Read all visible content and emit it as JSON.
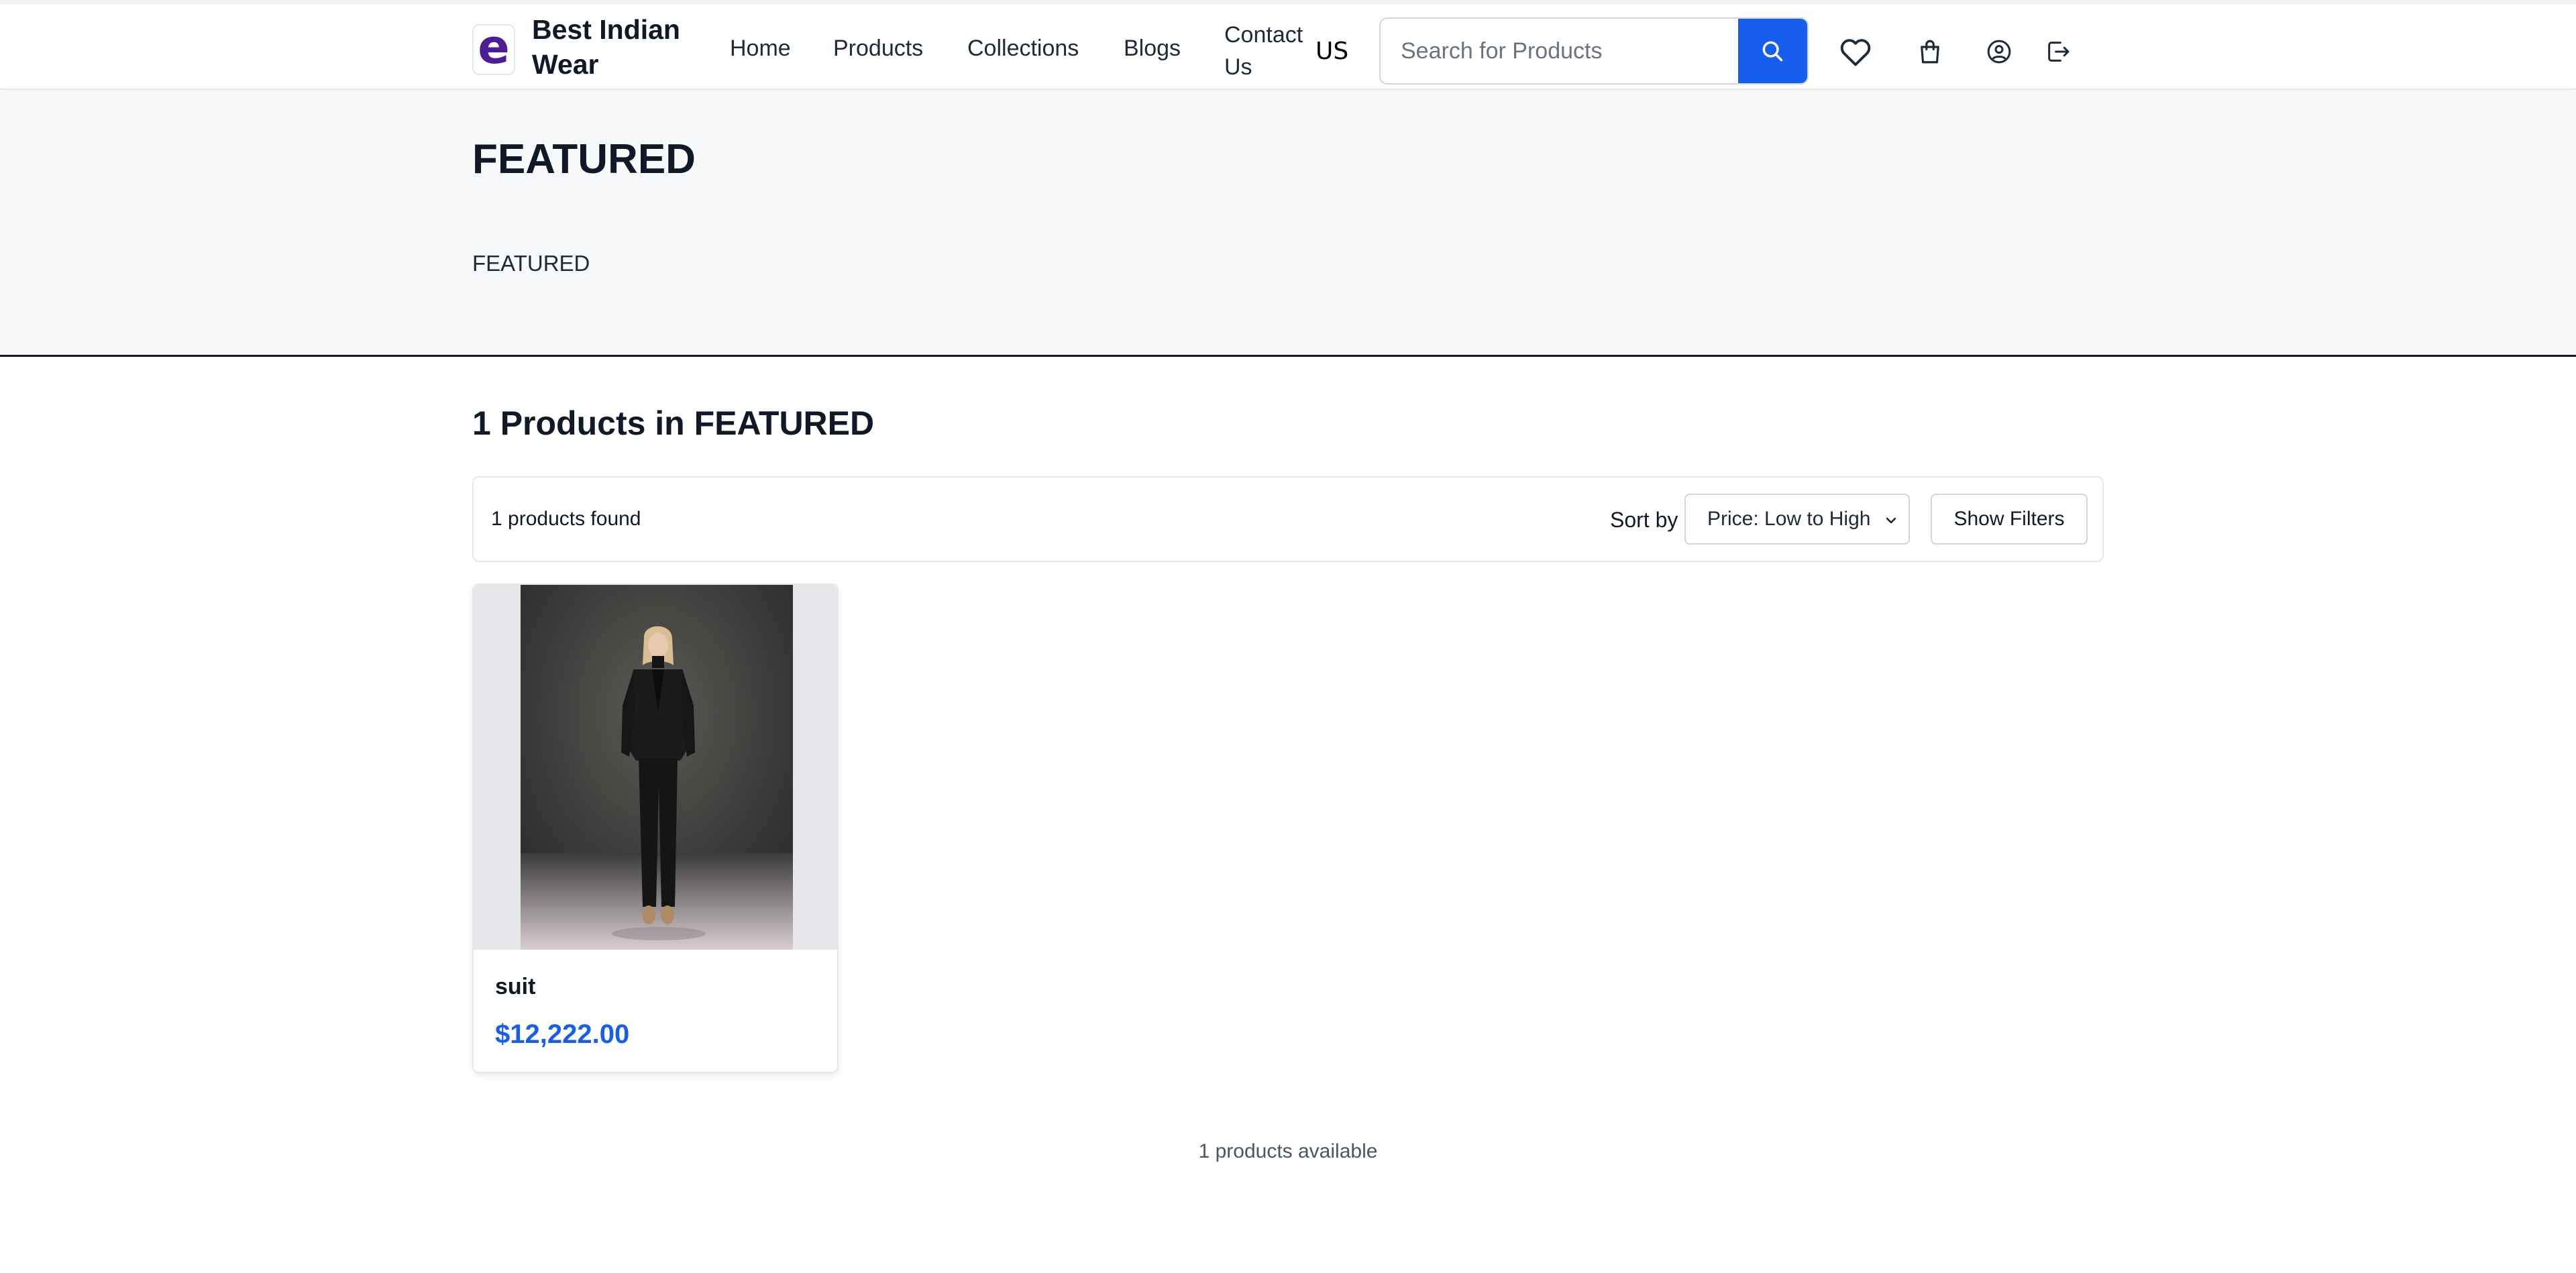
{
  "header": {
    "brand": "Best Indian Wear",
    "logo_letter": "e",
    "nav": {
      "home": "Home",
      "products": "Products",
      "collections": "Collections",
      "blogs": "Blogs",
      "contact": "Contact Us"
    },
    "region": "US",
    "search": {
      "placeholder": "Search for Products",
      "value": ""
    },
    "icons": [
      "search-icon",
      "heart-icon",
      "shopping-bag-icon",
      "user-circle-icon",
      "logout-icon"
    ]
  },
  "hero": {
    "title": "FEATURED",
    "subtitle": "FEATURED"
  },
  "listing": {
    "heading": "1 Products in FEATURED",
    "found_text": "1 products found",
    "sort_label": "Sort by",
    "sort_selected": "Price: Low to High",
    "filters_button": "Show Filters",
    "products": [
      {
        "name": "suit",
        "price": "$12,222.00"
      }
    ],
    "footer_text": "1 products available"
  },
  "colors": {
    "accent": "#155eef",
    "logo": "#4c1d95",
    "hero_bg": "#f8f9fb",
    "text": "#111827"
  }
}
